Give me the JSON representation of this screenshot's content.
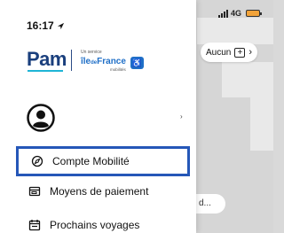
{
  "status": {
    "time": "16:17",
    "network": "4G"
  },
  "logo": {
    "brand": "Pam",
    "service_prefix": "Un service",
    "region_a": "île",
    "region_b": "de",
    "region_c": "France",
    "mobilites": "mobilités"
  },
  "map": {
    "filter_label": "Aucun",
    "chip_text": "d..."
  },
  "menu": {
    "items": [
      {
        "label": "Compte Mobilité",
        "icon": "compass-icon"
      },
      {
        "label": "Moyens de paiement",
        "icon": "card-icon"
      },
      {
        "label": "Prochains voyages",
        "icon": "calendar-icon"
      }
    ]
  },
  "colors": {
    "brand_blue": "#1a3f7d",
    "highlight": "#2557b8",
    "accent_cyan": "#1fb5d6"
  }
}
